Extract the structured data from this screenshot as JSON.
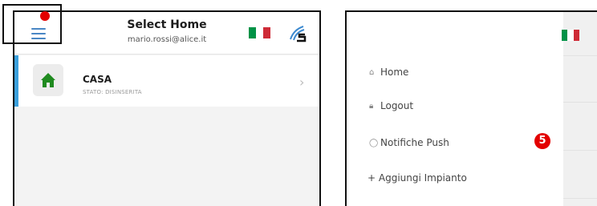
{
  "left": {
    "title": "Select Home",
    "subtitle": "mario.rossi@alice.it",
    "card": {
      "name": "CASA",
      "status": "STATO: DISINSERITA"
    }
  },
  "right": {
    "menu": [
      {
        "label": "Home",
        "icon": "home-icon"
      },
      {
        "label": "Logout",
        "icon": "lock-icon"
      },
      {
        "label": "Notifiche Push",
        "icon": "chat-bubble-icon"
      },
      {
        "label": "+ Aggiungi Impianto",
        "icon": ""
      }
    ],
    "step_badge": "5"
  },
  "colors": {
    "accent_blue": "#3aa0dd",
    "hamburger_blue": "#4a87c5",
    "annotation_red": "#e30000",
    "flag_green": "#009246",
    "flag_red": "#ce2b37",
    "house_green": "#1f8a1f"
  }
}
